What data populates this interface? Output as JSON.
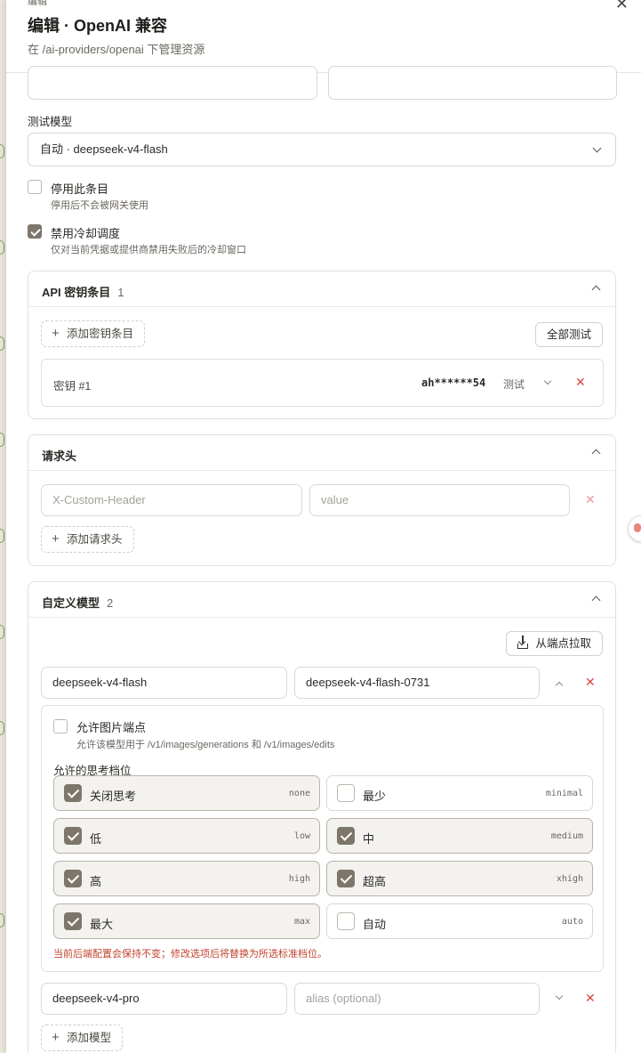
{
  "header": {
    "breadcrumb": "编辑",
    "title": "编辑 · OpenAI 兼容",
    "subtitle": "在 /ai-providers/openai 下管理资源"
  },
  "test_model": {
    "label": "测试模型",
    "value": "自动 · deepseek-v4-flash"
  },
  "disable_entry": {
    "checked": false,
    "title": "停用此条目",
    "desc": "停用后不会被网关使用"
  },
  "disable_cooldown": {
    "checked": true,
    "title": "禁用冷却调度",
    "desc": "仅对当前凭据或提供商禁用失败后的冷却窗口"
  },
  "api_keys": {
    "title": "API 密钥条目",
    "count": "1",
    "add_label": "添加密钥条目",
    "test_all_label": "全部测试",
    "keys": [
      {
        "name": "密钥 #1",
        "masked": "ah******54",
        "test_label": "测试"
      }
    ]
  },
  "headers": {
    "title": "请求头",
    "name_placeholder": "X-Custom-Header",
    "value_placeholder": "value",
    "add_label": "添加请求头"
  },
  "custom_models": {
    "title": "自定义模型",
    "count": "2",
    "fetch_label": "从端点拉取",
    "add_label": "添加模型",
    "models": [
      {
        "name": "deepseek-v4-flash",
        "alias": "deepseek-v4-flash-0731",
        "alias_placeholder": ""
      },
      {
        "name": "deepseek-v4-pro",
        "alias": "",
        "alias_placeholder": "alias (optional)"
      }
    ],
    "image_endpoint": {
      "checked": false,
      "title": "允许图片端点",
      "desc": "允许该模型用于 /v1/images/generations 和 /v1/images/edits"
    },
    "thinking_label": "允许的思考档位",
    "thinking_levels": [
      {
        "label": "关闭思考",
        "value": "none",
        "checked": true
      },
      {
        "label": "最少",
        "value": "minimal",
        "checked": false
      },
      {
        "label": "低",
        "value": "low",
        "checked": true
      },
      {
        "label": "中",
        "value": "medium",
        "checked": true
      },
      {
        "label": "高",
        "value": "high",
        "checked": true
      },
      {
        "label": "超高",
        "value": "xhigh",
        "checked": true
      },
      {
        "label": "最大",
        "value": "max",
        "checked": true
      },
      {
        "label": "自动",
        "value": "auto",
        "checked": false
      }
    ],
    "warning": "当前后端配置会保持不变；修改选项后将替换为所选标准档位。"
  }
}
